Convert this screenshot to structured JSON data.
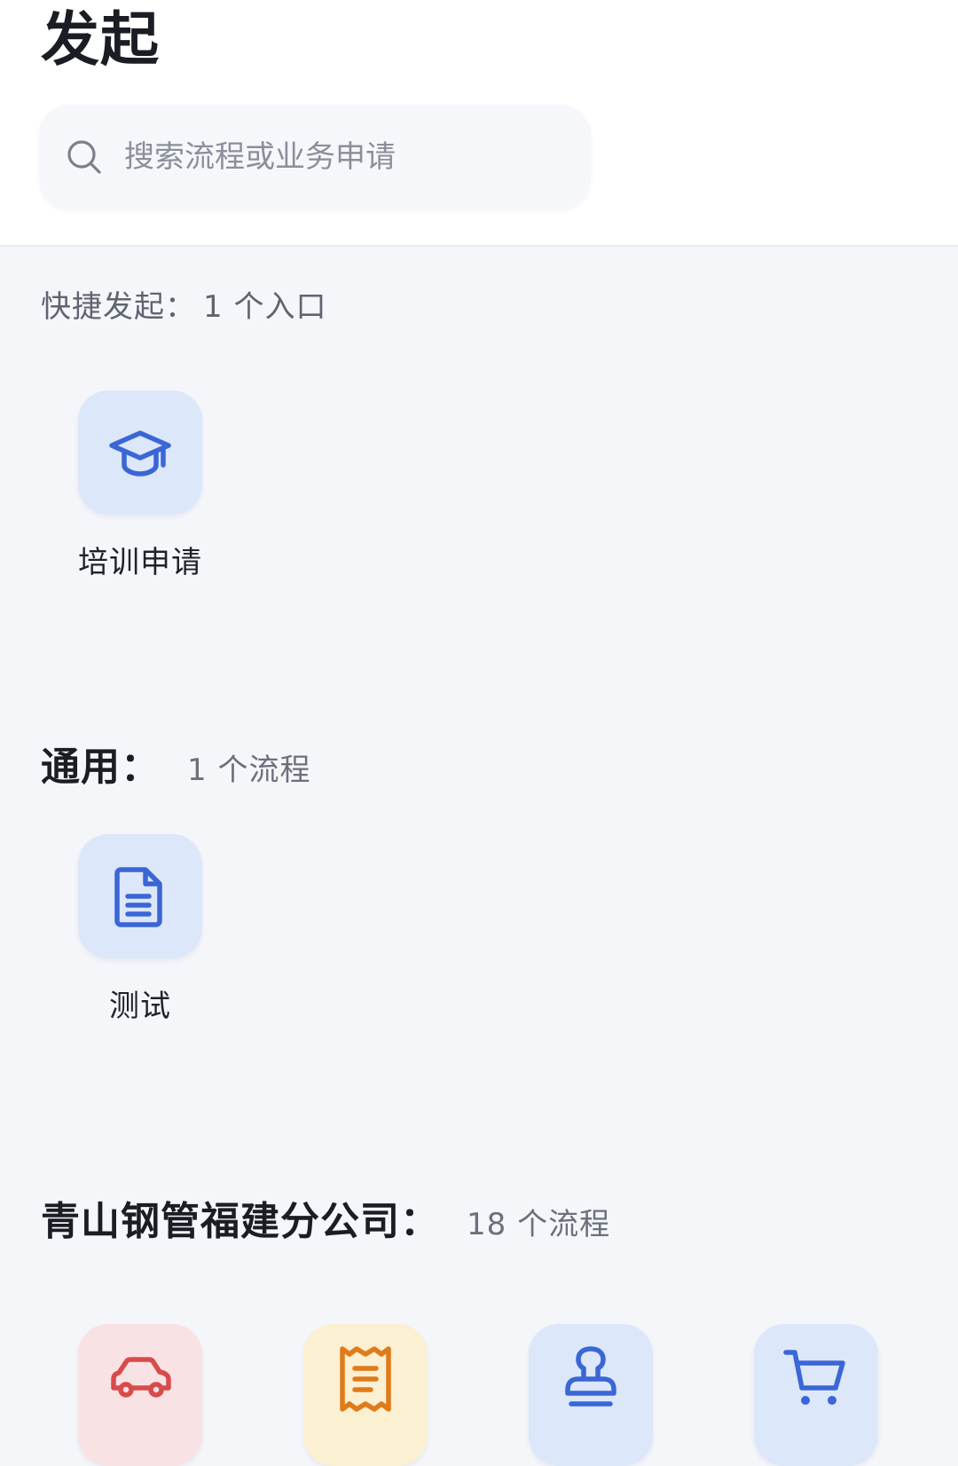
{
  "header": {
    "title": "发起",
    "search": {
      "placeholder": "搜索流程或业务申请",
      "value": ""
    }
  },
  "quick_start": {
    "label": "快捷发起：",
    "count": "1 个入口",
    "items": [
      {
        "label": "培训申请",
        "icon": "graduation-cap-icon"
      }
    ]
  },
  "general": {
    "label": "通用：",
    "count": "1 个流程",
    "items": [
      {
        "label": "测试",
        "icon": "document-icon"
      }
    ]
  },
  "company": {
    "label": "青山钢管福建分公司：",
    "count": "18 个流程",
    "items": [
      {
        "icon": "car-icon",
        "color": "#d94b4b"
      },
      {
        "icon": "receipt-icon",
        "color": "#e07b1a"
      },
      {
        "icon": "stamp-icon",
        "color": "#3a66d6"
      },
      {
        "icon": "shopping-cart-icon",
        "color": "#3a66d6"
      }
    ]
  },
  "colors": {
    "accent_blue": "#3a66d6",
    "accent_red": "#d94b4b",
    "accent_orange": "#e07b1a",
    "background": "#f4f6fa"
  }
}
